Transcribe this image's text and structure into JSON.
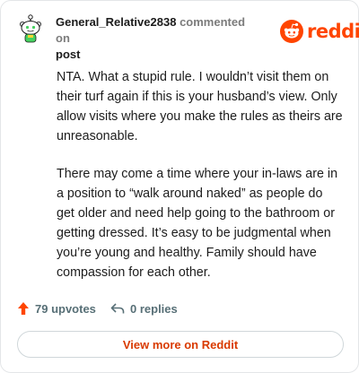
{
  "colors": {
    "brand": "#ff4500",
    "upvote": "#ff4500",
    "link": "#d93a00",
    "muted": "#7c7c7c",
    "action": "#576f76"
  },
  "comment": {
    "username": "General_Relative2838",
    "commented_on": "commented on",
    "post_label": "post",
    "paragraphs": [
      "NTA. What a stupid rule. I wouldn’t visit them on their turf again if this is your husband’s view. Only allow visits where you make the rules as theirs are unreasonable.",
      "There may come a time where your in-laws are in a position to “walk around naked” as people do get older and need help going to the bathroom or getting dressed. It’s easy to be judgmental when you’re young and healthy. Family should have compassion for each other."
    ]
  },
  "brand": {
    "wordmark": "reddit",
    "logo_icon": "reddit-alien-icon"
  },
  "actions": {
    "upvotes_label": "79 upvotes",
    "upvote_icon": "upvote-arrow-icon",
    "replies_label": "0 replies",
    "reply_icon": "reply-arrow-icon"
  },
  "view_more_label": "View more on Reddit"
}
